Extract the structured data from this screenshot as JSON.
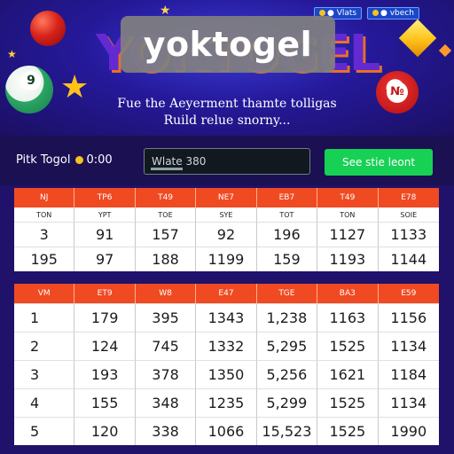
{
  "header": {
    "brand": "yoktogel",
    "background_logo": "YOKTOGEL",
    "tagline_line1": "Fue the Aeyerment thamte tolligas",
    "tagline_line2": "Ruild relue snorny...",
    "top_buttons": [
      "● Vlats",
      "● vbech"
    ],
    "green_ball_number": "9",
    "red_ball_number": "№"
  },
  "controls": {
    "label": "Pitk Togol",
    "time": "0:00",
    "input_value": "Wlate 380",
    "button_label": "See stie leont",
    "accent_green": "#17d154"
  },
  "table1": {
    "headers": [
      "NJ",
      "TP6",
      "T49",
      "NE7",
      "EB7",
      "T49",
      "E78"
    ],
    "subheaders": [
      "TON",
      "YPT",
      "TOE",
      "SYE",
      "TOT",
      "TON",
      "SOIE"
    ],
    "rows": [
      [
        "3",
        "91",
        "157",
        "92",
        "196",
        "1127",
        "1133"
      ],
      [
        "195",
        "97",
        "188",
        "1199",
        "159",
        "1193",
        "1144"
      ]
    ]
  },
  "table2": {
    "headers": [
      "VM",
      "ET9",
      "W8",
      "E47",
      "TGE",
      "BA3",
      "E59"
    ],
    "rows": [
      [
        "1",
        "179",
        "395",
        "1343",
        "1,238",
        "1163",
        "1156"
      ],
      [
        "2",
        "124",
        "745",
        "1332",
        "5,295",
        "1525",
        "1134"
      ],
      [
        "3",
        "193",
        "378",
        "1350",
        "5,256",
        "1621",
        "1184"
      ],
      [
        "4",
        "155",
        "348",
        "1235",
        "5,299",
        "1525",
        "1134"
      ],
      [
        "5",
        "120",
        "338",
        "1066",
        "15,523",
        "1525",
        "1990"
      ]
    ]
  },
  "colors": {
    "header_bg": "#25199a",
    "table_header": "#f04a22",
    "page_bg": "#20116a"
  }
}
